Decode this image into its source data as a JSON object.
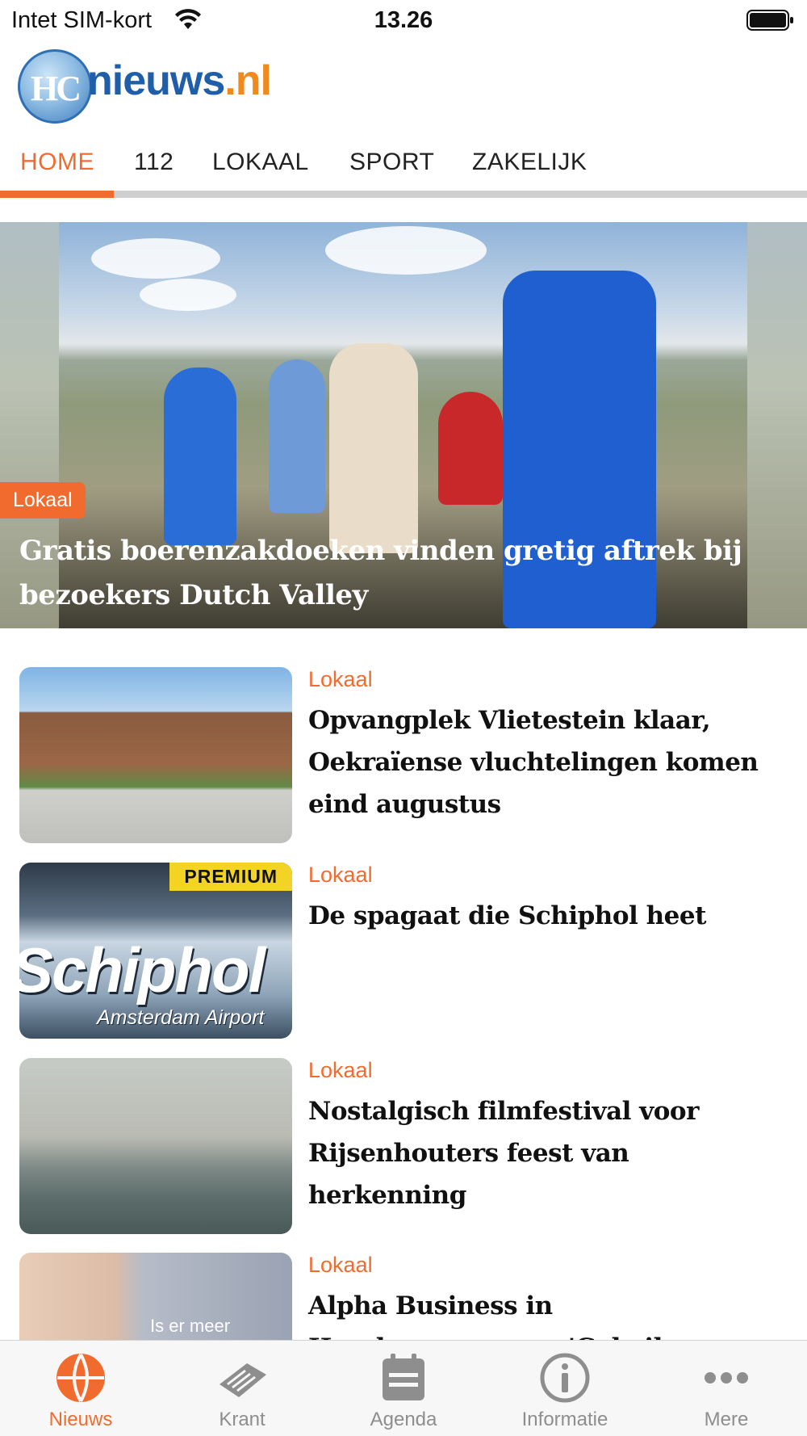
{
  "status_bar": {
    "carrier": "Intet SIM-kort",
    "time": "13.26",
    "icons": [
      "wifi-icon",
      "battery-icon"
    ]
  },
  "logo": {
    "mark": "HC",
    "name": "nieuws",
    "tld": ".nl"
  },
  "tabs": [
    {
      "label": "HOME",
      "active": true
    },
    {
      "label": "112",
      "active": false
    },
    {
      "label": "LOKAAL",
      "active": false
    },
    {
      "label": "SPORT",
      "active": false
    },
    {
      "label": "ZAKELIJK",
      "active": false
    }
  ],
  "hero": {
    "category": "Lokaal",
    "title": "Gratis boerenzakdoeken vinden gretig aftrek bij bezoekers Dutch Valley"
  },
  "articles": [
    {
      "category": "Lokaal",
      "title": "Opvangplek Vlietestein klaar, Oekraïense vluchtelingen komen eind augustus"
    },
    {
      "category": "Lokaal",
      "title": "De spagaat die Schiphol heet",
      "badge": "PREMIUM"
    },
    {
      "category": "Lokaal",
      "title": "Nostalgisch filmfestival voor Rijsenhouters feest van herkenning"
    },
    {
      "category": "Lokaal",
      "title": "Alpha Business in Haarlemmermeer: 'Gebeik"
    }
  ],
  "thumb_text": {
    "schiphol_sign": "Schiphol",
    "schiphol_sub": "Amsterdam Airport",
    "alpha_caption": "Is er meer"
  },
  "tabbar": [
    {
      "label": "Nieuws",
      "icon": "globe-icon",
      "active": true
    },
    {
      "label": "Krant",
      "icon": "newspaper-icon",
      "active": false
    },
    {
      "label": "Agenda",
      "icon": "calendar-icon",
      "active": false
    },
    {
      "label": "Informatie",
      "icon": "info-icon",
      "active": false
    },
    {
      "label": "Mere",
      "icon": "more-icon",
      "active": false
    }
  ],
  "colors": {
    "accent": "#f26b2e",
    "premium": "#f3d324",
    "logo_blue": "#1f5ea8",
    "logo_orange": "#f08a1c"
  }
}
